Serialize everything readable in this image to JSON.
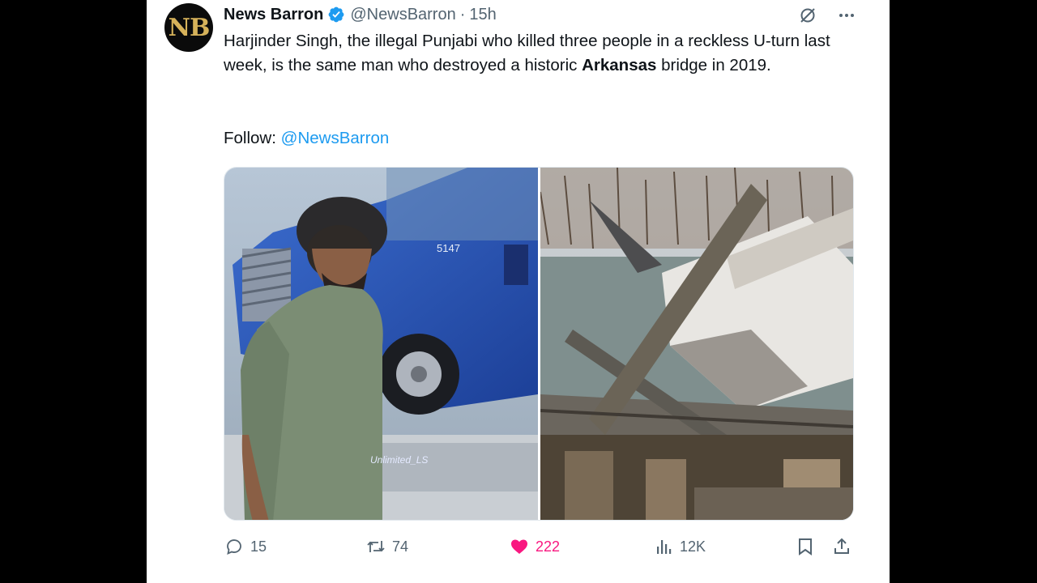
{
  "tweet": {
    "author_name": "News Barron",
    "avatar_initials": "NB",
    "handle": "@NewsBarron",
    "separator": "·",
    "time": "15h",
    "text_part1": "Harjinder Singh, the illegal Punjabi who killed three people in a reckless U-turn last week, is the same man who destroyed a historic ",
    "text_bold": "Arkansas",
    "text_part2": " bridge in 2019.",
    "follow_label": "Follow: ",
    "follow_mention": "@NewsBarron",
    "image_left_caption": "Unlimited_LS",
    "truck_number": "5147"
  },
  "actions": {
    "replies": "15",
    "reposts": "74",
    "likes": "222",
    "views": "12K"
  },
  "colors": {
    "accent": "#1d9bf0",
    "like": "#f91880",
    "muted": "#536471",
    "text": "#0f1419"
  },
  "icons": [
    "verified-badge-icon",
    "grok-icon",
    "more-icon",
    "reply-icon",
    "repost-icon",
    "like-icon",
    "views-icon",
    "bookmark-icon",
    "share-icon"
  ]
}
